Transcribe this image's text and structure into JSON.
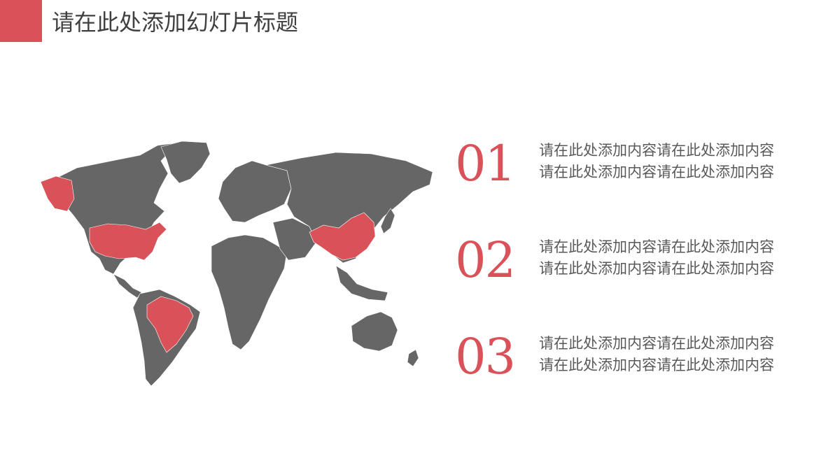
{
  "colors": {
    "accent": "#D9525A",
    "map_land": "#666666",
    "map_highlight": "#D9525A",
    "title_text": "#404040",
    "body_text": "#595959"
  },
  "slide": {
    "title": "请在此处添加幻灯片标题"
  },
  "map": {
    "highlighted_regions": [
      "USA",
      "Alaska",
      "Brazil",
      "China"
    ]
  },
  "items": [
    {
      "number": "01",
      "line1": "请在此处添加内容请在此处添加内容",
      "line2": "请在此处添加内容请在此处添加内容"
    },
    {
      "number": "02",
      "line1": "请在此处添加内容请在此处添加内容",
      "line2": "请在此处添加内容请在此处添加内容"
    },
    {
      "number": "03",
      "line1": "请在此处添加内容请在此处添加内容",
      "line2": "请在此处添加内容请在此处添加内容"
    }
  ]
}
